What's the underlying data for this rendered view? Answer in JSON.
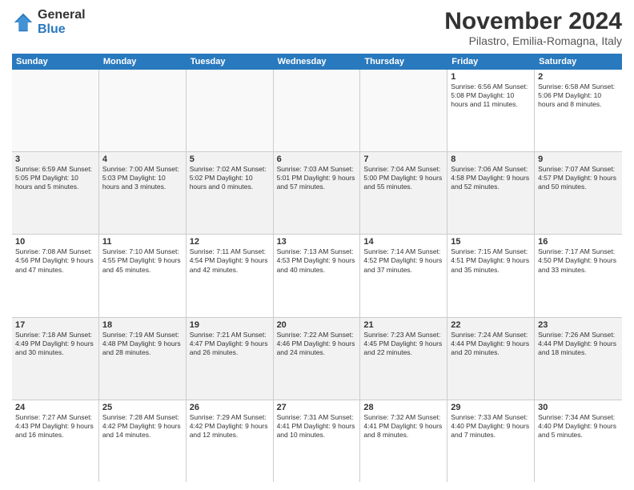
{
  "logo": {
    "line1": "General",
    "line2": "Blue"
  },
  "title": "November 2024",
  "location": "Pilastro, Emilia-Romagna, Italy",
  "days_of_week": [
    "Sunday",
    "Monday",
    "Tuesday",
    "Wednesday",
    "Thursday",
    "Friday",
    "Saturday"
  ],
  "rows": [
    {
      "alt": false,
      "cells": [
        {
          "day": "",
          "info": ""
        },
        {
          "day": "",
          "info": ""
        },
        {
          "day": "",
          "info": ""
        },
        {
          "day": "",
          "info": ""
        },
        {
          "day": "",
          "info": ""
        },
        {
          "day": "1",
          "info": "Sunrise: 6:56 AM\nSunset: 5:08 PM\nDaylight: 10 hours and 11 minutes."
        },
        {
          "day": "2",
          "info": "Sunrise: 6:58 AM\nSunset: 5:06 PM\nDaylight: 10 hours and 8 minutes."
        }
      ]
    },
    {
      "alt": true,
      "cells": [
        {
          "day": "3",
          "info": "Sunrise: 6:59 AM\nSunset: 5:05 PM\nDaylight: 10 hours and 5 minutes."
        },
        {
          "day": "4",
          "info": "Sunrise: 7:00 AM\nSunset: 5:03 PM\nDaylight: 10 hours and 3 minutes."
        },
        {
          "day": "5",
          "info": "Sunrise: 7:02 AM\nSunset: 5:02 PM\nDaylight: 10 hours and 0 minutes."
        },
        {
          "day": "6",
          "info": "Sunrise: 7:03 AM\nSunset: 5:01 PM\nDaylight: 9 hours and 57 minutes."
        },
        {
          "day": "7",
          "info": "Sunrise: 7:04 AM\nSunset: 5:00 PM\nDaylight: 9 hours and 55 minutes."
        },
        {
          "day": "8",
          "info": "Sunrise: 7:06 AM\nSunset: 4:58 PM\nDaylight: 9 hours and 52 minutes."
        },
        {
          "day": "9",
          "info": "Sunrise: 7:07 AM\nSunset: 4:57 PM\nDaylight: 9 hours and 50 minutes."
        }
      ]
    },
    {
      "alt": false,
      "cells": [
        {
          "day": "10",
          "info": "Sunrise: 7:08 AM\nSunset: 4:56 PM\nDaylight: 9 hours and 47 minutes."
        },
        {
          "day": "11",
          "info": "Sunrise: 7:10 AM\nSunset: 4:55 PM\nDaylight: 9 hours and 45 minutes."
        },
        {
          "day": "12",
          "info": "Sunrise: 7:11 AM\nSunset: 4:54 PM\nDaylight: 9 hours and 42 minutes."
        },
        {
          "day": "13",
          "info": "Sunrise: 7:13 AM\nSunset: 4:53 PM\nDaylight: 9 hours and 40 minutes."
        },
        {
          "day": "14",
          "info": "Sunrise: 7:14 AM\nSunset: 4:52 PM\nDaylight: 9 hours and 37 minutes."
        },
        {
          "day": "15",
          "info": "Sunrise: 7:15 AM\nSunset: 4:51 PM\nDaylight: 9 hours and 35 minutes."
        },
        {
          "day": "16",
          "info": "Sunrise: 7:17 AM\nSunset: 4:50 PM\nDaylight: 9 hours and 33 minutes."
        }
      ]
    },
    {
      "alt": true,
      "cells": [
        {
          "day": "17",
          "info": "Sunrise: 7:18 AM\nSunset: 4:49 PM\nDaylight: 9 hours and 30 minutes."
        },
        {
          "day": "18",
          "info": "Sunrise: 7:19 AM\nSunset: 4:48 PM\nDaylight: 9 hours and 28 minutes."
        },
        {
          "day": "19",
          "info": "Sunrise: 7:21 AM\nSunset: 4:47 PM\nDaylight: 9 hours and 26 minutes."
        },
        {
          "day": "20",
          "info": "Sunrise: 7:22 AM\nSunset: 4:46 PM\nDaylight: 9 hours and 24 minutes."
        },
        {
          "day": "21",
          "info": "Sunrise: 7:23 AM\nSunset: 4:45 PM\nDaylight: 9 hours and 22 minutes."
        },
        {
          "day": "22",
          "info": "Sunrise: 7:24 AM\nSunset: 4:44 PM\nDaylight: 9 hours and 20 minutes."
        },
        {
          "day": "23",
          "info": "Sunrise: 7:26 AM\nSunset: 4:44 PM\nDaylight: 9 hours and 18 minutes."
        }
      ]
    },
    {
      "alt": false,
      "cells": [
        {
          "day": "24",
          "info": "Sunrise: 7:27 AM\nSunset: 4:43 PM\nDaylight: 9 hours and 16 minutes."
        },
        {
          "day": "25",
          "info": "Sunrise: 7:28 AM\nSunset: 4:42 PM\nDaylight: 9 hours and 14 minutes."
        },
        {
          "day": "26",
          "info": "Sunrise: 7:29 AM\nSunset: 4:42 PM\nDaylight: 9 hours and 12 minutes."
        },
        {
          "day": "27",
          "info": "Sunrise: 7:31 AM\nSunset: 4:41 PM\nDaylight: 9 hours and 10 minutes."
        },
        {
          "day": "28",
          "info": "Sunrise: 7:32 AM\nSunset: 4:41 PM\nDaylight: 9 hours and 8 minutes."
        },
        {
          "day": "29",
          "info": "Sunrise: 7:33 AM\nSunset: 4:40 PM\nDaylight: 9 hours and 7 minutes."
        },
        {
          "day": "30",
          "info": "Sunrise: 7:34 AM\nSunset: 4:40 PM\nDaylight: 9 hours and 5 minutes."
        }
      ]
    }
  ]
}
